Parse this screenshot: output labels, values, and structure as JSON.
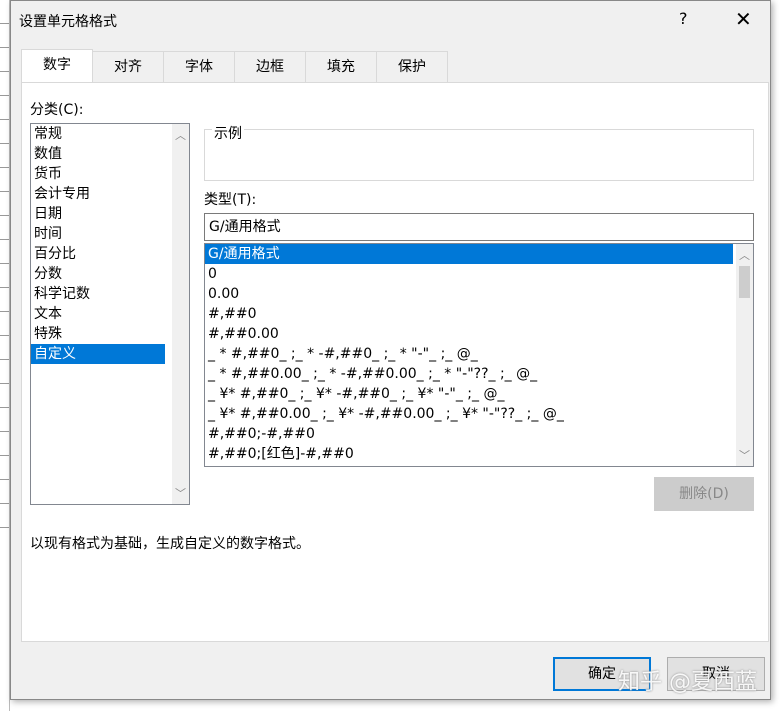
{
  "dialog": {
    "title": "设置单元格格式",
    "help": "?",
    "close": "✕"
  },
  "tabs": [
    "数字",
    "对齐",
    "字体",
    "边框",
    "填充",
    "保护"
  ],
  "category": {
    "label": "分类(C):",
    "items": [
      "常规",
      "数值",
      "货币",
      "会计专用",
      "日期",
      "时间",
      "百分比",
      "分数",
      "科学记数",
      "文本",
      "特殊",
      "自定义"
    ],
    "selected": 11
  },
  "sample": {
    "label": "示例"
  },
  "type": {
    "label": "类型(T):",
    "value": "G/通用格式",
    "items": [
      "G/通用格式",
      "0",
      "0.00",
      "#,##0",
      "#,##0.00",
      "_ * #,##0_ ;_ * -#,##0_ ;_ * \"-\"_ ;_ @_ ",
      "_ * #,##0.00_ ;_ * -#,##0.00_ ;_ * \"-\"??_ ;_ @_ ",
      "_ ¥* #,##0_ ;_ ¥* -#,##0_ ;_ ¥* \"-\"_ ;_ @_ ",
      "_ ¥* #,##0.00_ ;_ ¥* -#,##0.00_ ;_ ¥* \"-\"??_ ;_ @_ ",
      "#,##0;-#,##0",
      "#,##0;[红色]-#,##0"
    ],
    "selected": 0
  },
  "delete_label": "删除(D)",
  "description": "以现有格式为基础，生成自定义的数字格式。",
  "ok_label": "确定",
  "cancel_label": "取消",
  "watermark": "知乎 @夏西蓝"
}
